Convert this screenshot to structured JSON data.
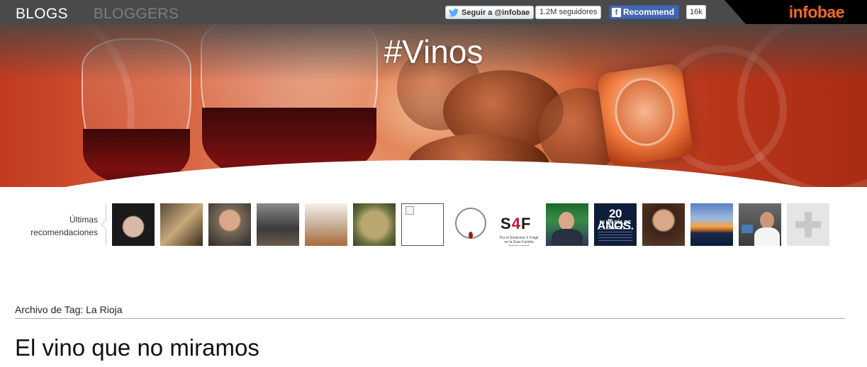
{
  "nav": {
    "blogs": "BLOGS",
    "bloggers": "BLOGGERS"
  },
  "social": {
    "twitter_label": "Seguir a @infobae",
    "twitter_count": "1.2M seguidores",
    "facebook_label": "Recommend",
    "facebook_count": "16k"
  },
  "logo": "infobae",
  "banner": {
    "title": "#Vinos"
  },
  "recommendations": {
    "label": "Últimas recomendaciones",
    "s4f_text_s": "S",
    "s4f_text_4": "4",
    "s4f_text_f": "F",
    "s4f_sub": "Por el Síndrome X Frágil en la Gran Familia Internacional",
    "poster_big": "20 AÑOS.",
    "poster_mid": "NI UN DÍA DE OLVIDO"
  },
  "archive": {
    "label": "Archivo de Tag:",
    "tag": "La Rioja"
  },
  "post": {
    "title": "El vino que no miramos"
  },
  "colors": {
    "topbar": "#4a4a4a",
    "logo": "#f26a21",
    "facebook": "#4267b2",
    "banner_accent": "#c23a1d"
  }
}
